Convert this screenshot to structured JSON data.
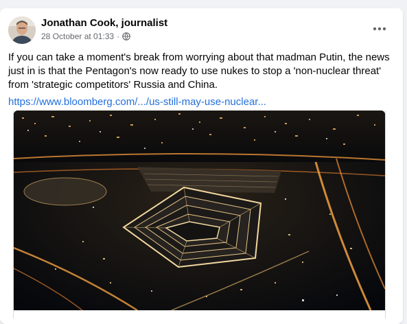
{
  "post": {
    "author": "Jonathan Cook, journalist",
    "timestamp": "28 October at 01:33",
    "separator": "·",
    "privacy_icon": "globe-icon",
    "more_icon": "more-options-icon",
    "text": "If you can take a moment's break from worrying about that madman Putin, the news just in is that the Pentagon's now ready to use nukes to stop a 'non-nuclear threat' from 'strategic competitors' Russia and China.",
    "link_text": "https://www.bloomberg.com/.../us-still-may-use-nuclear...",
    "image_icon": "pentagon-night-aerial-image"
  },
  "colors": {
    "link": "#216fdb",
    "author": "#050505",
    "meta": "#65676b",
    "background": "#f0f2f5",
    "card": "#ffffff"
  }
}
